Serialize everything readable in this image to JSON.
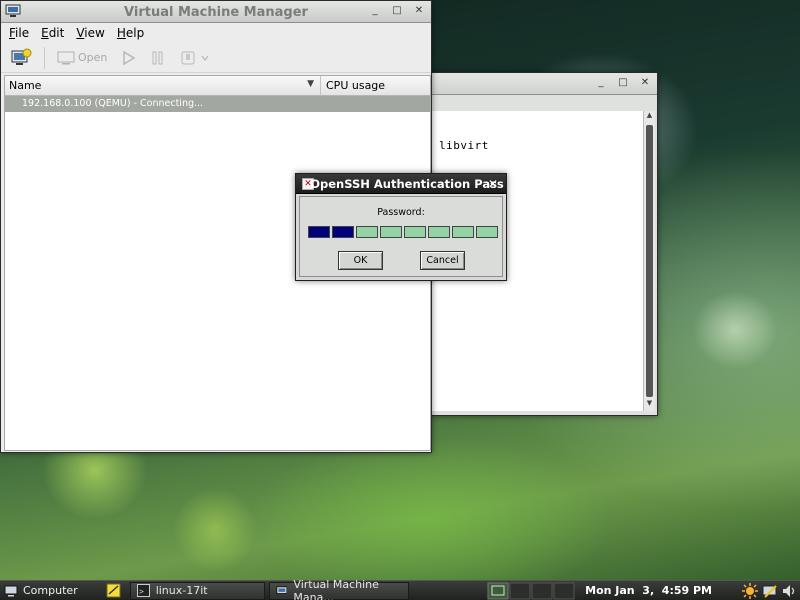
{
  "terminal": {
    "text": "libvirt",
    "controls": {
      "minimize": "_",
      "maximize": "□",
      "close": "✕"
    }
  },
  "vmm": {
    "title": "Virtual Machine Manager",
    "controls": {
      "minimize": "_",
      "maximize": "□",
      "close": "✕"
    },
    "menu": [
      {
        "label": "File",
        "accel": "F",
        "rest": "ile"
      },
      {
        "label": "Edit",
        "accel": "E",
        "rest": "dit"
      },
      {
        "label": "View",
        "accel": "V",
        "rest": "iew"
      },
      {
        "label": "Help",
        "accel": "H",
        "rest": "elp"
      }
    ],
    "toolbar": {
      "open_label": "Open"
    },
    "columns": {
      "name": "Name",
      "cpu": "CPU usage"
    },
    "rows": [
      {
        "name": "192.168.0.100 (QEMU) - Connecting..."
      }
    ]
  },
  "dialog": {
    "title": "OpenSSH Authentication Pass",
    "close": "✕",
    "app_icon": "✕",
    "prompt": "Password:",
    "entered_cells": 2,
    "total_cells": 8,
    "ok_label": "OK",
    "cancel_label": "Cancel",
    "colors": {
      "filled": "#00007a",
      "empty": "#94d4a4"
    }
  },
  "taskbar": {
    "computer_label": "Computer",
    "tasks": [
      {
        "label": "linux-17it",
        "icon": "terminal-icon"
      },
      {
        "label": "Virtual Machine Mana...",
        "icon": "vmm-icon"
      }
    ],
    "clock": "Mon Jan  3,  4:59 PM"
  }
}
